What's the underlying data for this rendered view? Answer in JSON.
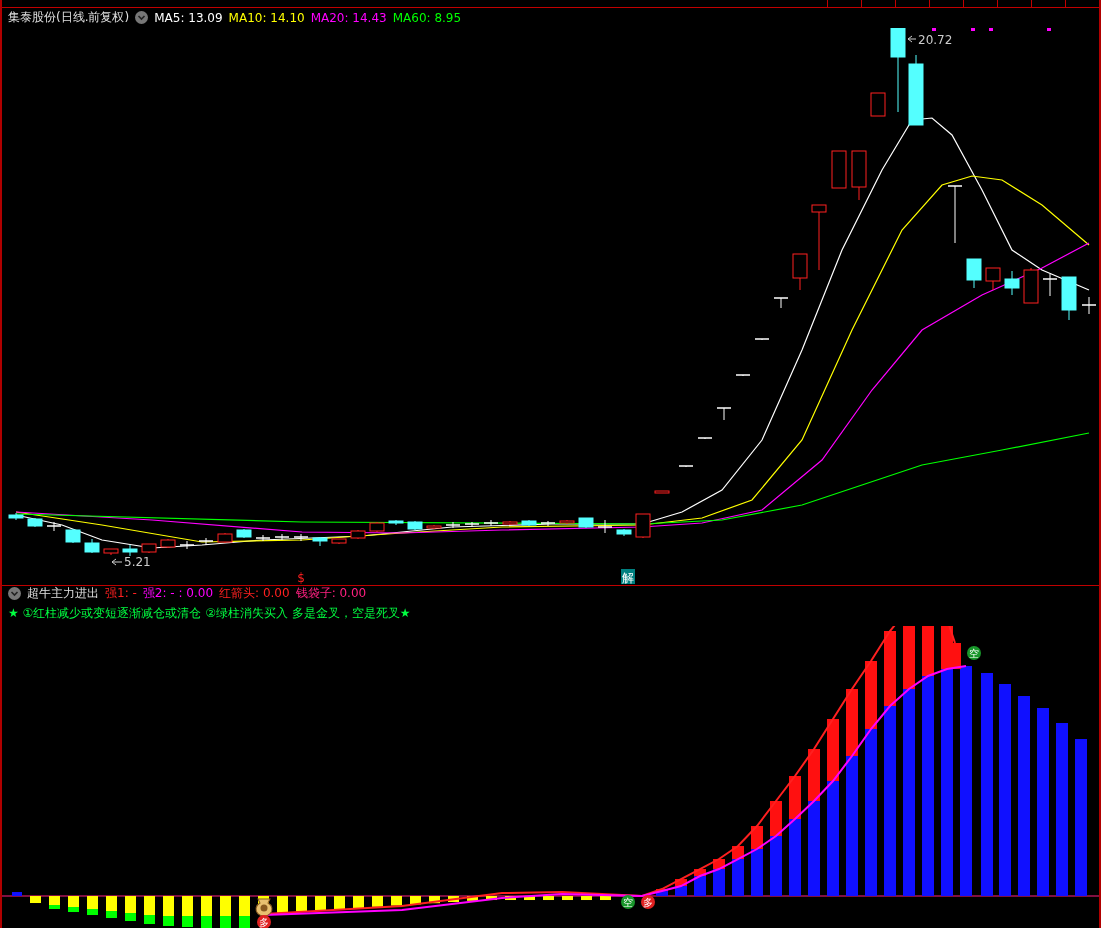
{
  "header": {
    "title": "集泰股份(日线.前复权)",
    "indicators": [
      {
        "label": "MA5: 13.09",
        "color": "#ffffff"
      },
      {
        "label": "MA10: 14.10",
        "color": "#ffff00"
      },
      {
        "label": "MA20: 14.43",
        "color": "#ff00ff"
      },
      {
        "label": "MA60: 8.95",
        "color": "#00ff00"
      }
    ]
  },
  "price_chart": {
    "high_label": "20.72",
    "low_label": "5.21",
    "signals": [
      {
        "kind": "dollar",
        "text": "$"
      },
      {
        "kind": "unlock",
        "text": "解"
      }
    ]
  },
  "indicator": {
    "title": "超牛主力进出",
    "values": [
      {
        "text": "强1: -",
        "color": "#ff2020"
      },
      {
        "text": "强2: - : 0.00",
        "color": "#ff00ff"
      },
      {
        "text": "红箭头: 0.00",
        "color": "#ff2020"
      },
      {
        "text": "钱袋子: 0.00",
        "color": "#ff2080"
      }
    ],
    "legend": "★ ①红柱减少或变短逐渐减仓或清仓 ②绿柱消失买入 多是金叉，空是死叉★",
    "markers": [
      {
        "text": "多",
        "color": "#e02020"
      },
      {
        "text": "空",
        "color": "#18962a"
      },
      {
        "text": "多",
        "color": "#e02020"
      },
      {
        "text": "空",
        "color": "#18962a"
      }
    ]
  }
}
